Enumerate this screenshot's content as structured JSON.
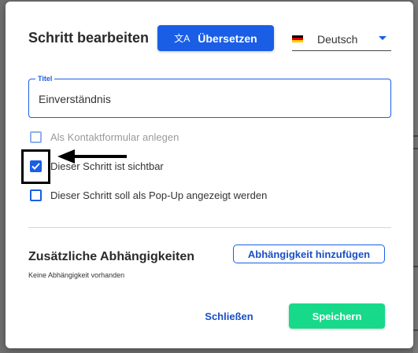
{
  "dialog": {
    "title": "Schritt bearbeiten",
    "translate_button": {
      "label": "Übersetzen",
      "icon": "translate-icon"
    },
    "language": {
      "selected": "Deutsch",
      "flag": "germany-flag"
    }
  },
  "title_field": {
    "label": "Titel",
    "value": "Einverständnis"
  },
  "checkboxes": [
    {
      "label": "Als Kontaktformular anlegen",
      "checked": false,
      "disabled": true
    },
    {
      "label": "Dieser Schritt ist sichtbar",
      "checked": true,
      "disabled": false
    },
    {
      "label": "Dieser Schritt soll als Pop-Up angezeigt werden",
      "checked": false,
      "disabled": false
    }
  ],
  "dependencies": {
    "title": "Zusätzliche Abhängigkeiten",
    "add_button": "Abhängigkeit hinzufügen",
    "empty_text": "Keine Abhängigkeit vorhanden"
  },
  "footer": {
    "close_label": "Schließen",
    "save_label": "Speichern"
  },
  "colors": {
    "primary": "#1a5ee6",
    "save": "#17d98a",
    "overlay": "#6f6f6f"
  }
}
